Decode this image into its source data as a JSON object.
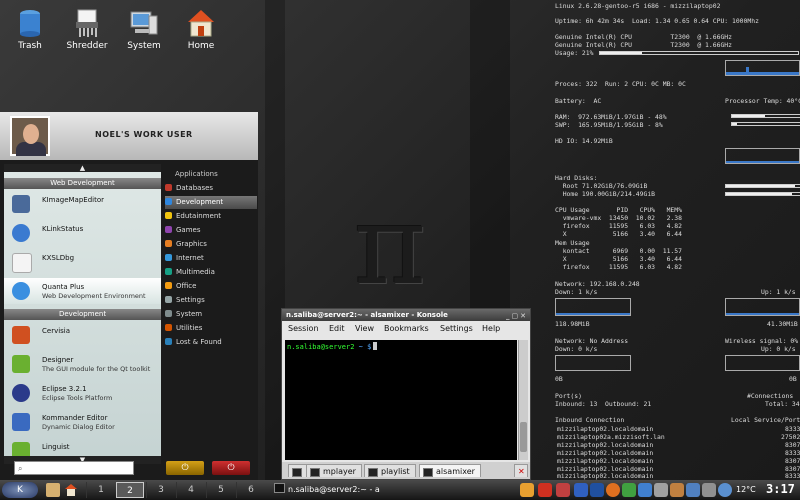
{
  "desktop_icons": [
    {
      "label": "Trash",
      "icon": "trash-icon"
    },
    {
      "label": "Shredder",
      "icon": "shredder-icon"
    },
    {
      "label": "System",
      "icon": "system-icon"
    },
    {
      "label": "Home",
      "icon": "home-icon"
    }
  ],
  "wallpaper_symbol": "π",
  "menu": {
    "user_title": "NOEL'S WORK USER",
    "categories": {
      "web": "Web Development",
      "dev": "Development"
    },
    "apps": [
      {
        "name": "KImageMapEditor",
        "desc": ""
      },
      {
        "name": "KLinkStatus",
        "desc": ""
      },
      {
        "name": "KXSLDbg",
        "desc": ""
      },
      {
        "name": "Quanta Plus",
        "desc": "Web Development Environment"
      },
      {
        "name": "Cervisia",
        "desc": ""
      },
      {
        "name": "Designer",
        "desc": "The GUI module for the Qt toolkit"
      },
      {
        "name": "Eclipse 3.2.1",
        "desc": "Eclipse Tools Platform"
      },
      {
        "name": "Kommander Editor",
        "desc": "Dynamic Dialog Editor"
      },
      {
        "name": "Linguist",
        "desc": ""
      }
    ],
    "right_header": "Applications",
    "right_items": [
      "Databases",
      "Development",
      "Edutainment",
      "Games",
      "Graphics",
      "Internet",
      "Multimedia",
      "Office",
      "Settings",
      "System",
      "Utilities",
      "Lost & Found"
    ],
    "selected_item": "Development"
  },
  "konsole": {
    "title": "n.saliba@server2:~ - alsamixer - Konsole",
    "menu": [
      "Session",
      "Edit",
      "View",
      "Bookmarks",
      "Settings",
      "Help"
    ],
    "prompt_user": "n.saliba@server2",
    "prompt_path": "~ $",
    "tabs": [
      "mplayer",
      "playlist",
      "alsamixer"
    ],
    "active_tab": "alsamixer"
  },
  "conky": {
    "sysline": "Linux 2.6.28-gentoo-r5 i686 - mizzilaptop02",
    "uptime": "Uptime: 6h 42m 34s  Load: 1.34 0.65 0.64 CPU: 1000Mhz",
    "cpu1": "Genuine Intel(R) CPU          T2300  @ 1.66GHz",
    "cpu2": "Genuine Intel(R) CPU          T2300  @ 1.66GHz",
    "usage": "Usage: 21%",
    "usage_value": 21,
    "procs": "Proces: 322  Run: 2 CPU: 0C MB: 0C",
    "battery": "Battery:  AC",
    "proc_temp": "Processor Temp: 40°C",
    "ram": "RAM:  972.63MiB/1.97GiB - 48%",
    "ram_value": 48,
    "swap": "SWP:  165.95MiB/1.95GiB - 8%",
    "swap_value": 8,
    "hdio": "HD IO: 14.92MiB",
    "hd_title": "Hard Disks:",
    "root": "  Root 71.02GiB/76.09GiB",
    "root_value": 93,
    "home": "  Home 190.00GiB/214.49GiB",
    "home_value": 89,
    "cpu_table": [
      "CPU Usage       PID   CPU%   MEM%",
      "  vmware-vmx  13450  10.02   2.38",
      "  firefox     11595   6.03   4.82",
      "  X            5166   3.40   6.44",
      "Mem Usage",
      "  kontact      6969   0.00  11.57",
      "  X            5166   3.40   6.44",
      "  firefox     11595   6.03   4.82"
    ],
    "network1": "Network: 192.168.0.248",
    "down1": "Down: 1 k/s",
    "up1": "Up: 1 k/s",
    "rx1": "118.98MiB",
    "tx1": "41.30MiB",
    "network2": "Network: No Address",
    "wireless": "Wireless signal: 0%",
    "down2": "Down: 0 k/s",
    "up2": "Up: 0 k/s",
    "rx2": "0B",
    "tx2": "0B",
    "ports": "Port(s)",
    "connections": "#Connections",
    "inout": "Inbound: 13  Outbound: 21",
    "total": "Total: 34",
    "inbound_hdr": "Inbound Connection",
    "service_hdr": "Local Service/Port",
    "conns": [
      [
        "mizzilaptop02.localdomain",
        "8333"
      ],
      [
        "mizzilaptop02a.mizzisoft.lan",
        "27502"
      ],
      [
        "mizzilaptop02.localdomain",
        "8307"
      ],
      [
        "mizzilaptop02.localdomain",
        "8333"
      ],
      [
        "mizzilaptop02.localdomain",
        "8307"
      ],
      [
        "mizzilaptop02.localdomain",
        "8307"
      ],
      [
        "mizzilaptop02.localdomain",
        "8333"
      ]
    ]
  },
  "taskbar": {
    "desktops": [
      "1",
      "2",
      "3",
      "4",
      "5",
      "6"
    ],
    "active_desktop": "2",
    "task_label": "n.saliba@server2:~ - a",
    "temperature": "12°C",
    "clock": "3:17"
  }
}
